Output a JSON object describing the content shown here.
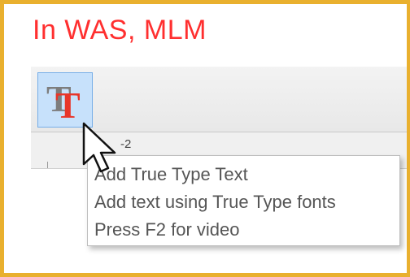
{
  "header": {
    "title": "In WAS, MLM"
  },
  "toolbar": {
    "buttons": [
      {
        "icon": "true-type-text-icon",
        "glyph_back": "T",
        "glyph_front": "T"
      }
    ]
  },
  "ruler": {
    "label": "-2"
  },
  "tooltip": {
    "title": "Add True Type Text",
    "description": "Add text using True Type fonts",
    "hint": "Press F2 for video"
  },
  "colors": {
    "frame_border": "#e9b02e",
    "title_red": "#ff2f2f",
    "button_highlight": "#c7e1fb",
    "button_border": "#76aee8",
    "icon_gray_t": "#7d7d7d",
    "icon_red_t": "#e8352a"
  }
}
